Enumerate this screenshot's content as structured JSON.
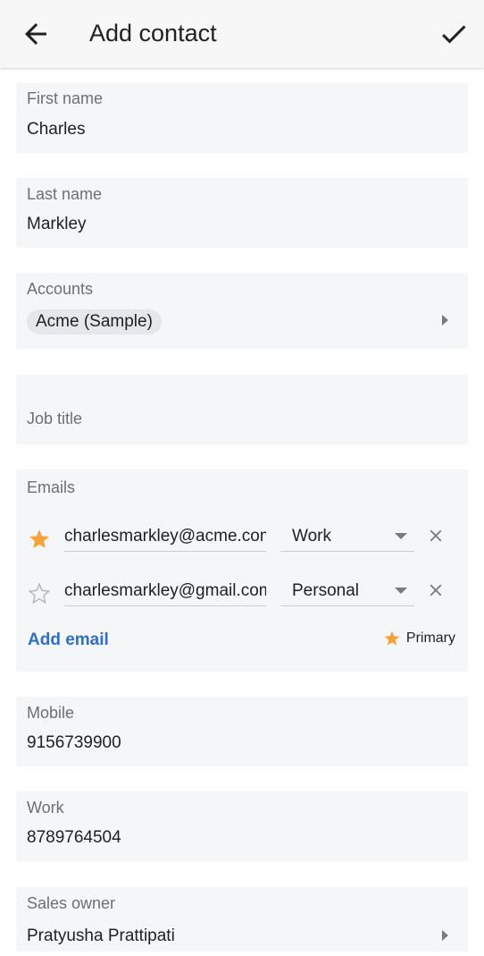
{
  "appbar": {
    "title": "Add contact",
    "back_icon": "arrow-left-icon",
    "save_icon": "check-icon"
  },
  "fields": {
    "first_name": {
      "label": "First name",
      "value": "Charles"
    },
    "last_name": {
      "label": "Last name",
      "value": "Markley"
    },
    "accounts": {
      "label": "Accounts",
      "chip": "Acme (Sample)"
    },
    "job_title": {
      "placeholder": "Job title"
    },
    "emails": {
      "label": "Emails",
      "items": [
        {
          "value": "charlesmarkley@acme.com",
          "type": "Work",
          "primary": true
        },
        {
          "value": "charlesmarkley@gmail.com",
          "type": "Personal",
          "primary": false
        }
      ],
      "add_label": "Add email",
      "primary_legend": "Primary"
    },
    "mobile": {
      "label": "Mobile",
      "value": "9156739900"
    },
    "work": {
      "label": "Work",
      "value": "8789764504"
    },
    "sales_owner": {
      "label": "Sales owner",
      "value": "Pratyusha Prattipati"
    }
  },
  "colors": {
    "accent_blue": "#2f6fc4",
    "star_orange": "#f5a23a",
    "card_bg": "#f5f6f8"
  }
}
